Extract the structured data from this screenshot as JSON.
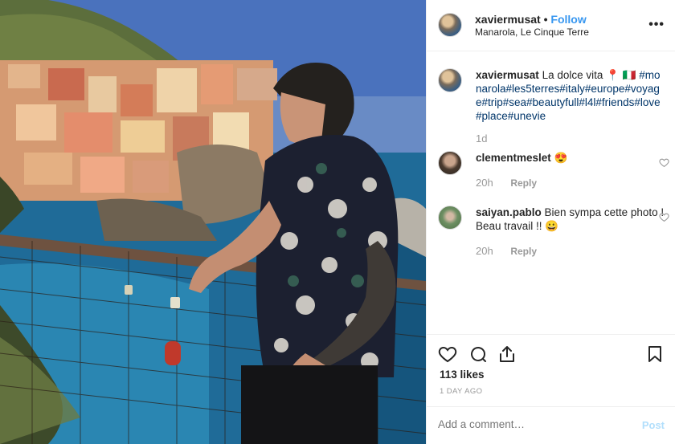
{
  "post": {
    "author": "xaviermusat",
    "follow_label": "Follow",
    "location": "Manarola, Le Cinque Terre",
    "more_label": "•••",
    "caption": {
      "username": "xaviermusat",
      "text": "La dolce vita 📍 🇮🇹",
      "hashtags": "#monarola#les5terres#italy#europe#voyage#trip#sea#beautyfull#l4l#friends#love#place#unevie",
      "age": "1d"
    },
    "comments": [
      {
        "username": "clementmeslet",
        "text": "😍",
        "age": "20h",
        "reply_label": "Reply"
      },
      {
        "username": "saiyan.pablo",
        "text": "Bien sympa cette photo ! Beau travail !! 😀",
        "age": "20h",
        "reply_label": "Reply"
      }
    ],
    "likes": "113 likes",
    "date": "1 DAY AGO",
    "add_comment_placeholder": "Add a comment…",
    "post_label": "Post"
  },
  "colors": {
    "link": "#3897f0",
    "hashtag": "#003569",
    "muted": "#999999",
    "post_disabled": "#b2dffc"
  },
  "icons": [
    "heart-icon",
    "comment-icon",
    "share-icon",
    "bookmark-icon",
    "more-icon",
    "small-heart-icon"
  ]
}
